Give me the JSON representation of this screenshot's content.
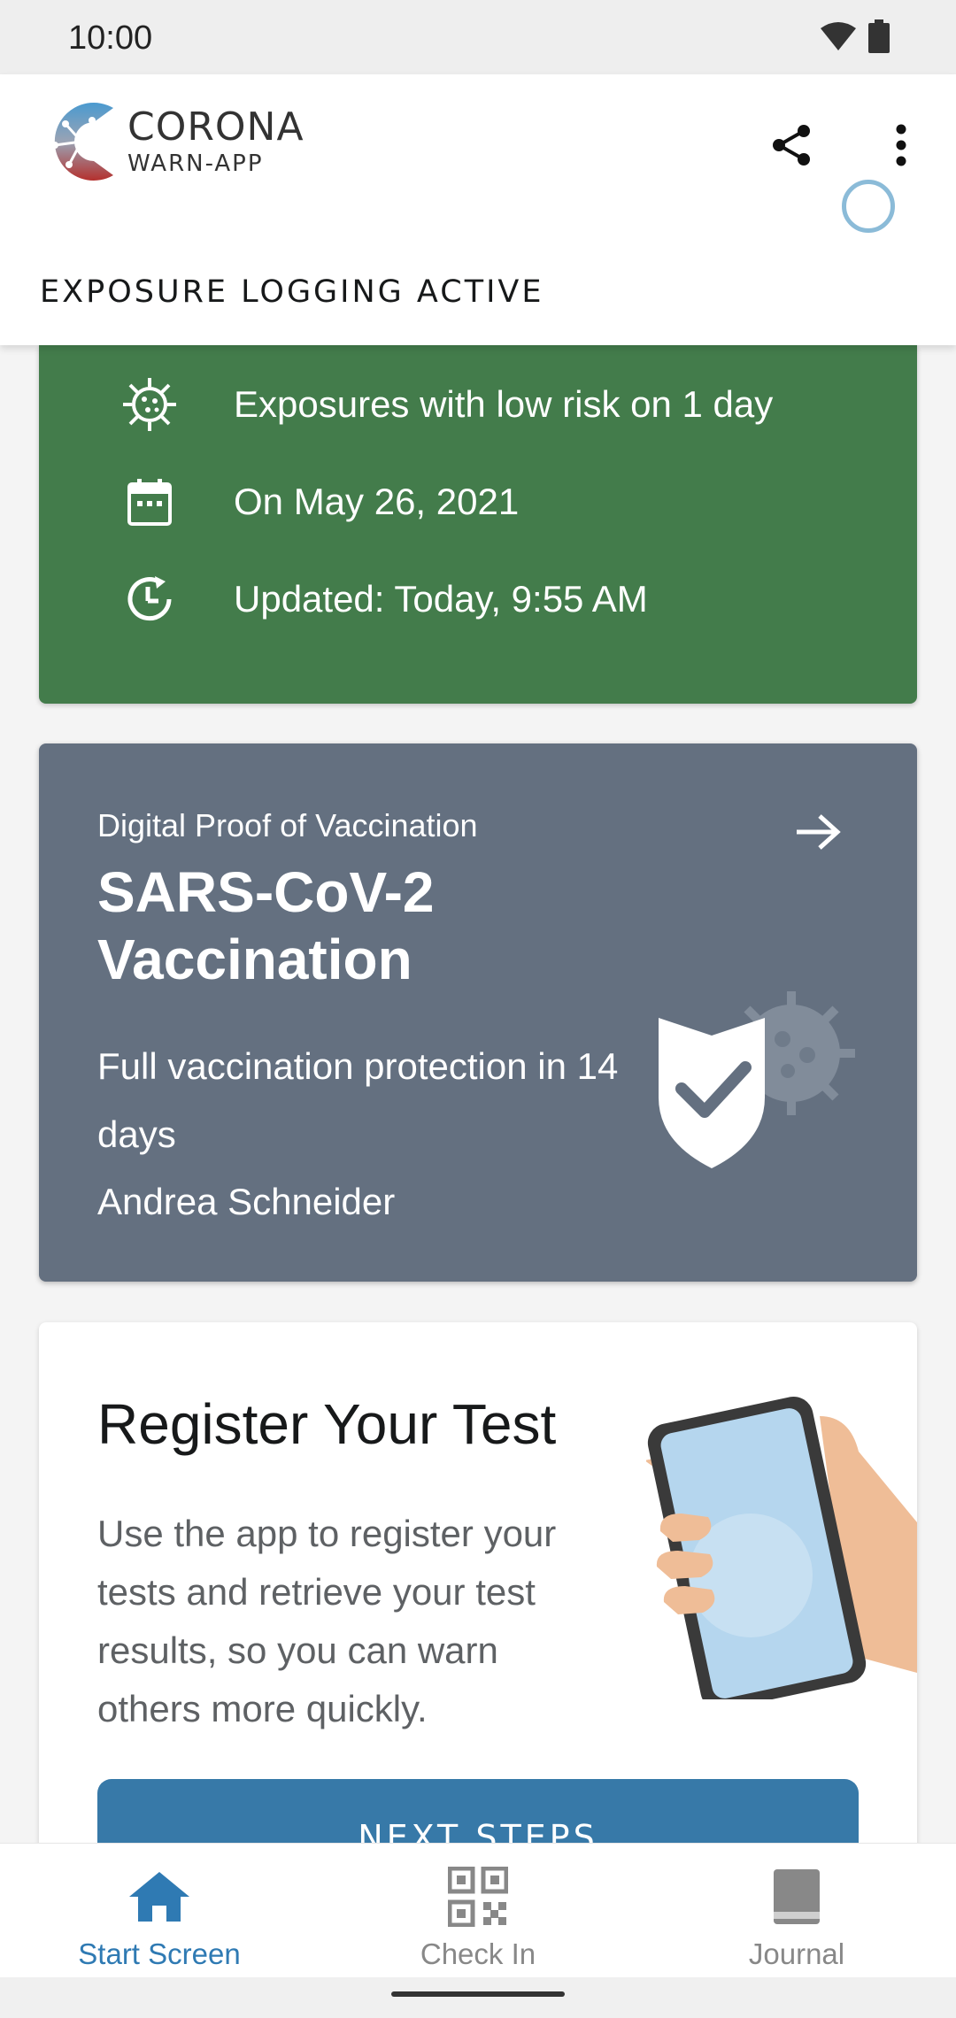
{
  "status_bar": {
    "time": "10:00"
  },
  "header": {
    "logo_title": "CORONA",
    "logo_subtitle": "WARN-APP",
    "exposure_status": "EXPOSURE LOGGING ACTIVE"
  },
  "risk_card": {
    "exposures": "Exposures with low risk on 1 day",
    "date": "On May 26, 2021",
    "updated": "Updated: Today, 9:55 AM"
  },
  "vaccination_card": {
    "subtitle": "Digital Proof of Vaccination",
    "title": "SARS-CoV-2 Vaccination",
    "status": "Full vaccination protection in 14 days",
    "name": "Andrea Schneider"
  },
  "test_card": {
    "title": "Register Your Test",
    "description": "Use the app to register your tests and retrieve your test results, so you can warn others more quickly.",
    "button_label": "NEXT STEPS"
  },
  "bottom_nav": {
    "items": [
      {
        "label": "Start Screen",
        "icon": "home-icon",
        "active": true
      },
      {
        "label": "Check In",
        "icon": "qr-code-icon",
        "active": false
      },
      {
        "label": "Journal",
        "icon": "book-icon",
        "active": false
      }
    ]
  },
  "colors": {
    "risk_green": "#437c4b",
    "vaccination_gray": "#647080",
    "primary_blue": "#3779a8",
    "active_nav": "#2f7ab3"
  }
}
